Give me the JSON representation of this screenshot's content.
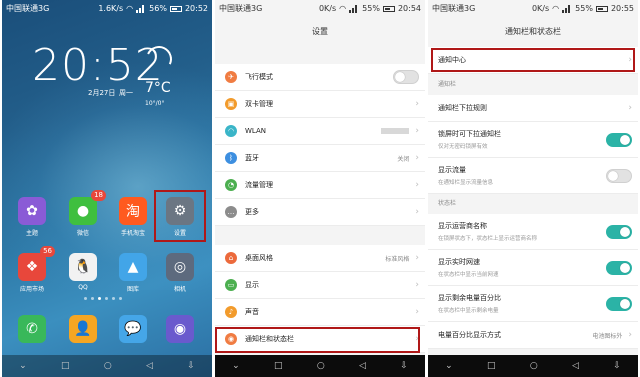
{
  "home": {
    "status": {
      "carrier": "中国联通3G",
      "speed": "1.6K/s",
      "battery": "56%",
      "time": "20:52"
    },
    "clock": "20:52",
    "date": "2月27日",
    "weekday": "周一",
    "temperature": "7°C",
    "temp_range": "10°/0°",
    "apps_row1": [
      {
        "label": "主题",
        "icon": "theme-icon",
        "color": "#8a5bd6"
      },
      {
        "label": "微信",
        "icon": "wechat-icon",
        "color": "#3fbf3f",
        "badge": "18"
      },
      {
        "label": "手机淘宝",
        "icon": "taobao-icon",
        "color": "#ff5a1f",
        "glyph": "淘"
      },
      {
        "label": "设置",
        "icon": "gear-icon",
        "color": "#6b7683",
        "glyph": "⚙"
      }
    ],
    "apps_row2": [
      {
        "label": "应用市场",
        "icon": "app-market-icon",
        "color": "#e8473b",
        "badge": "56"
      },
      {
        "label": "QQ",
        "icon": "qq-icon",
        "color": "#f2f2f2"
      },
      {
        "label": "图库",
        "icon": "gallery-icon",
        "color": "#42a5e8"
      },
      {
        "label": "相机",
        "icon": "camera-icon",
        "color": "#5d6a7e"
      }
    ],
    "dock": [
      {
        "icon": "phone-icon",
        "color": "#39b85a",
        "glyph": "✆"
      },
      {
        "icon": "contacts-icon",
        "color": "#f5a623",
        "glyph": "👤"
      },
      {
        "icon": "messages-icon",
        "color": "#45a6e8",
        "glyph": "💬"
      },
      {
        "icon": "browser-icon",
        "color": "#6a5acd",
        "glyph": "◉"
      }
    ]
  },
  "settings": {
    "status": {
      "carrier": "中国联通3G",
      "speed": "0K/s",
      "battery": "55%",
      "time": "20:54"
    },
    "title": "设置",
    "group1": [
      {
        "label": "飞行模式",
        "icon": "airplane-icon",
        "color": "#f07c42",
        "control": "toggle",
        "on": false
      },
      {
        "label": "双卡管理",
        "icon": "sim-icon",
        "color": "#f29b2c",
        "control": "chevron"
      },
      {
        "label": "WLAN",
        "icon": "wifi-icon",
        "color": "#3ab5c8",
        "control": "chevron",
        "blurred": true
      },
      {
        "label": "蓝牙",
        "icon": "bluetooth-icon",
        "color": "#3d8fe0",
        "control": "chevron",
        "value": "关闭"
      },
      {
        "label": "流量管理",
        "icon": "data-usage-icon",
        "color": "#4caf50",
        "control": "chevron"
      },
      {
        "label": "更多",
        "icon": "more-icon",
        "color": "#8c8c8c",
        "control": "chevron"
      }
    ],
    "group2": [
      {
        "label": "桌面风格",
        "icon": "home-style-icon",
        "color": "#ec6a3c",
        "control": "chevron",
        "value": "标准风格"
      },
      {
        "label": "显示",
        "icon": "display-icon",
        "color": "#4caf50",
        "control": "chevron"
      },
      {
        "label": "声音",
        "icon": "sound-icon",
        "color": "#f29b2c",
        "control": "chevron"
      },
      {
        "label": "通知栏和状态栏",
        "icon": "notification-icon",
        "color": "#f07c42",
        "control": "chevron"
      }
    ]
  },
  "notify": {
    "status": {
      "carrier": "中国联通3G",
      "speed": "0K/s",
      "battery": "55%",
      "time": "20:55"
    },
    "title": "通知栏和状态栏",
    "center": "通知中心",
    "section1": "通知栏",
    "section1_rows": [
      {
        "label": "通知栏下拉规则",
        "control": "chevron"
      },
      {
        "label": "锁屏时可下拉通知栏",
        "sub": "仅对无密码锁屏有效",
        "control": "toggle",
        "on": true
      },
      {
        "label": "显示流量",
        "sub": "在通知栏显示流量信息",
        "control": "toggle",
        "on": false
      }
    ],
    "section2": "状态栏",
    "section2_rows": [
      {
        "label": "显示运营商名称",
        "sub": "在锁屏状态下，状态栏上显示运营商名称",
        "control": "toggle",
        "on": true
      },
      {
        "label": "显示实时网速",
        "sub": "在状态栏中显示当前网速",
        "control": "toggle",
        "on": true
      },
      {
        "label": "显示剩余电量百分比",
        "sub": "在状态栏中显示剩余电量",
        "control": "toggle",
        "on": true
      },
      {
        "label": "电量百分比显示方式",
        "value": "电池图标外",
        "control": "chevron"
      }
    ]
  }
}
